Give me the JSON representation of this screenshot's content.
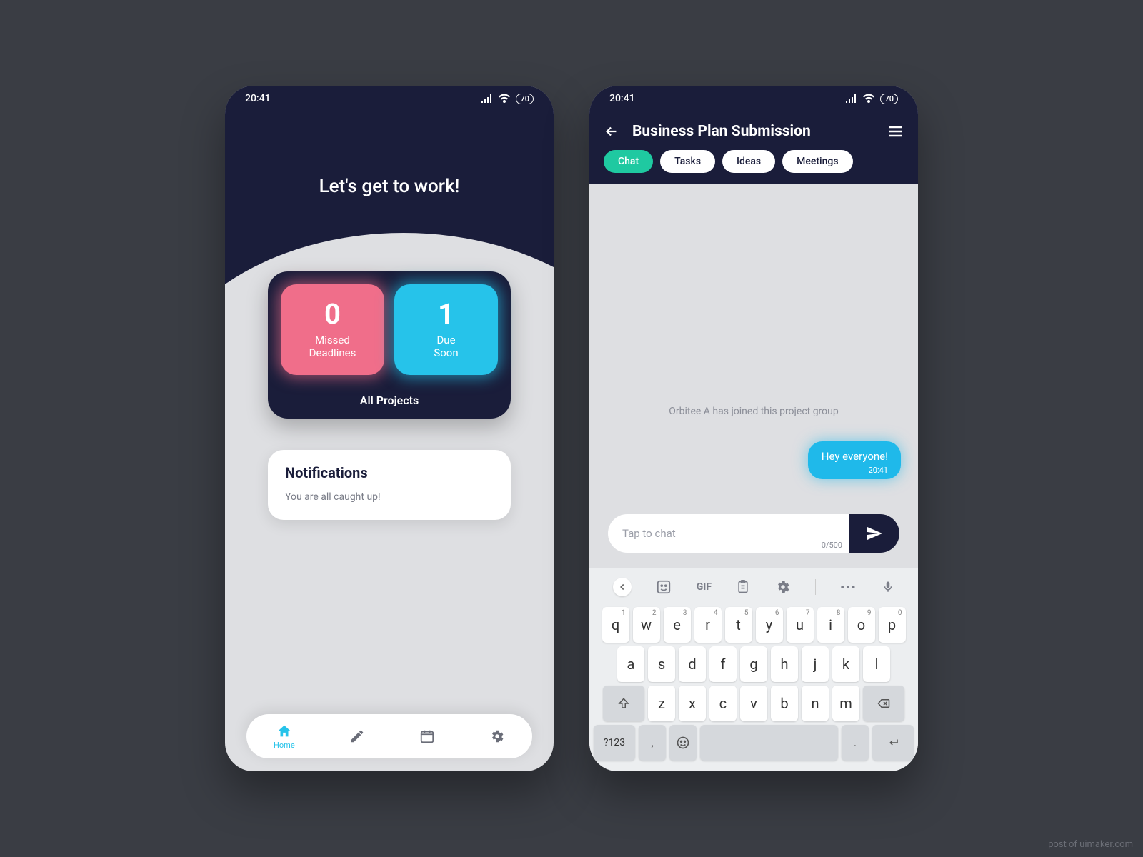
{
  "status": {
    "time": "20:41",
    "battery": "70"
  },
  "phone1": {
    "greeting": "Let's get to work!",
    "stats": {
      "missed": {
        "value": "0",
        "label1": "Missed",
        "label2": "Deadlines"
      },
      "due": {
        "value": "1",
        "label1": "Due",
        "label2": "Soon"
      },
      "all_projects": "All Projects"
    },
    "notifications": {
      "title": "Notifications",
      "body": "You are all caught up!"
    },
    "nav": {
      "home": "Home"
    }
  },
  "phone2": {
    "title": "Business Plan Submission",
    "tabs": [
      "Chat",
      "Tasks",
      "Ideas",
      "Meetings"
    ],
    "system_message": "Orbitee A has joined this project group",
    "bubble": {
      "text": "Hey everyone!",
      "time": "20:41"
    },
    "input": {
      "placeholder": "Tap to chat",
      "char_count": "0/500"
    },
    "keyboard": {
      "row1": [
        "q",
        "w",
        "e",
        "r",
        "t",
        "y",
        "u",
        "i",
        "o",
        "p"
      ],
      "row1sup": [
        "1",
        "2",
        "3",
        "4",
        "5",
        "6",
        "7",
        "8",
        "9",
        "0"
      ],
      "row2": [
        "a",
        "s",
        "d",
        "f",
        "g",
        "h",
        "j",
        "k",
        "l"
      ],
      "row3": [
        "z",
        "x",
        "c",
        "v",
        "b",
        "n",
        "m"
      ],
      "symkey": "?123",
      "gif": "GIF"
    }
  },
  "watermark": "post of uimaker.com"
}
